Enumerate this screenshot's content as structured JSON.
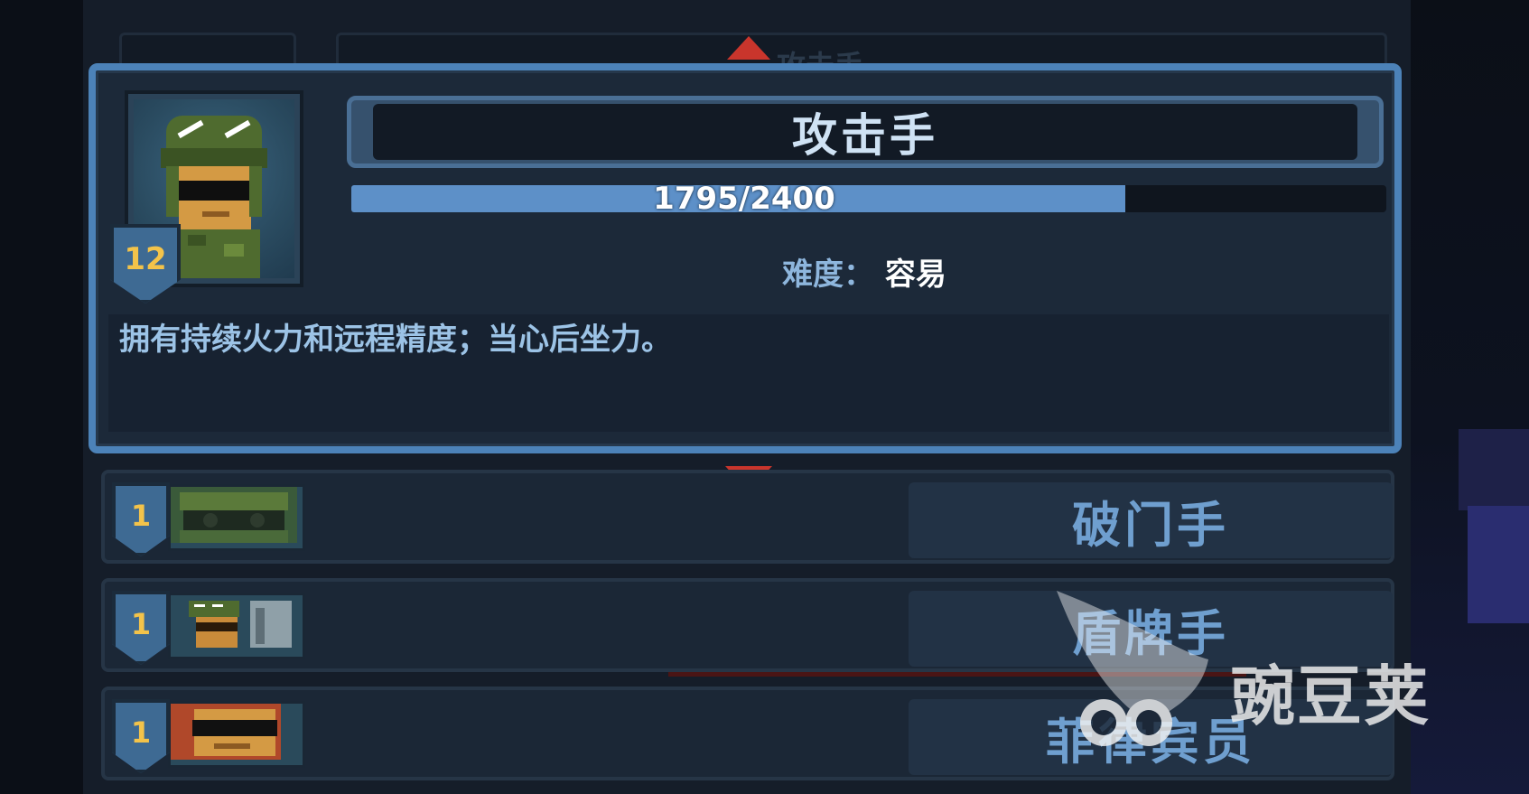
{
  "selected_class": {
    "name": "攻击手",
    "level": "12",
    "xp_text": "1795/2400",
    "xp_progress": 0.748,
    "difficulty_label": "难度：",
    "difficulty_value": "容易",
    "description": "拥有持续火力和远程精度；当心后坐力。"
  },
  "class_list": [
    {
      "name": "破门手",
      "level": "1"
    },
    {
      "name": "盾牌手",
      "level": "1"
    },
    {
      "name": "菲律宾员",
      "level": "1"
    }
  ],
  "ghost_title": "攻击手",
  "watermark": "豌豆荚",
  "colors": {
    "frame_accent": "#4c82b8",
    "xp_fill": "#5d90c8",
    "level_text": "#f3c34a",
    "arrow": "#c9352c"
  }
}
